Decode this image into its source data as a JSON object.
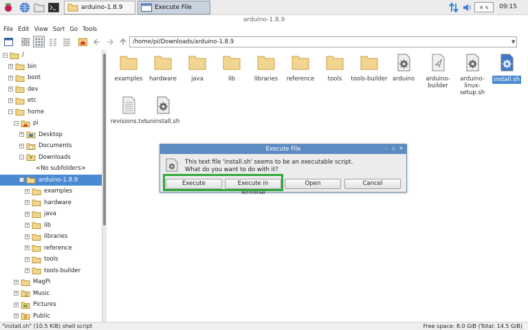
{
  "taskbar": {
    "windows": [
      "arduino-1.8.9",
      "Execute File"
    ],
    "cpu": "0 %",
    "clock": "09:15"
  },
  "window_title": "arduino-1.8.9",
  "menu": [
    "File",
    "Edit",
    "View",
    "Sort",
    "Go",
    "Tools"
  ],
  "address": "/home/pi/Downloads/arduino-1.8.9",
  "tree": [
    {
      "label": "/",
      "depth": 0,
      "exp": "-"
    },
    {
      "label": "bin",
      "depth": 1,
      "exp": "+"
    },
    {
      "label": "boot",
      "depth": 1,
      "exp": "+"
    },
    {
      "label": "dev",
      "depth": 1,
      "exp": "+"
    },
    {
      "label": "etc",
      "depth": 1,
      "exp": "+"
    },
    {
      "label": "home",
      "depth": 1,
      "exp": "-"
    },
    {
      "label": "pi",
      "depth": 2,
      "exp": "-",
      "icon": "home"
    },
    {
      "label": "Desktop",
      "depth": 3,
      "exp": "+",
      "icon": "desktop"
    },
    {
      "label": "Documents",
      "depth": 3,
      "exp": "+",
      "icon": "documents"
    },
    {
      "label": "Downloads",
      "depth": 3,
      "exp": "-",
      "icon": "downloads"
    },
    {
      "label": "<No subfolders>",
      "depth": 4,
      "exp": "",
      "icon": "none"
    },
    {
      "label": "arduino-1.8.9",
      "depth": 3,
      "exp": "-",
      "selected": true
    },
    {
      "label": "examples",
      "depth": 4,
      "exp": "+"
    },
    {
      "label": "hardware",
      "depth": 4,
      "exp": "+"
    },
    {
      "label": "java",
      "depth": 4,
      "exp": "+"
    },
    {
      "label": "lib",
      "depth": 4,
      "exp": "+"
    },
    {
      "label": "libraries",
      "depth": 4,
      "exp": "+"
    },
    {
      "label": "reference",
      "depth": 4,
      "exp": "+"
    },
    {
      "label": "tools",
      "depth": 4,
      "exp": "+"
    },
    {
      "label": "tools-builder",
      "depth": 4,
      "exp": "+"
    },
    {
      "label": "MagPi",
      "depth": 2,
      "exp": "+"
    },
    {
      "label": "Music",
      "depth": 2,
      "exp": "+",
      "icon": "music"
    },
    {
      "label": "Pictures",
      "depth": 2,
      "exp": "+",
      "icon": "pictures"
    },
    {
      "label": "Public",
      "depth": 2,
      "exp": "+",
      "icon": "public"
    }
  ],
  "files": [
    {
      "name": "examples",
      "kind": "folder"
    },
    {
      "name": "hardware",
      "kind": "folder"
    },
    {
      "name": "java",
      "kind": "folder"
    },
    {
      "name": "lib",
      "kind": "folder"
    },
    {
      "name": "libraries",
      "kind": "folder"
    },
    {
      "name": "reference",
      "kind": "folder"
    },
    {
      "name": "tools",
      "kind": "folder"
    },
    {
      "name": "tools-builder",
      "kind": "folder"
    },
    {
      "name": "arduino",
      "kind": "exec"
    },
    {
      "name": "arduino-builder",
      "kind": "builder"
    },
    {
      "name": "arduino-linux-setup.sh",
      "kind": "exec"
    },
    {
      "name": "install.sh",
      "kind": "exec",
      "selected": true
    },
    {
      "name": "revisions.txt",
      "kind": "text"
    },
    {
      "name": "uninstall.sh",
      "kind": "exec"
    }
  ],
  "dialog": {
    "title": "Execute File",
    "line1": "This text file 'install.sh' seems to be an executable script.",
    "line2": "What do you want to do with it?",
    "buttons": [
      "Execute",
      "Execute in Terminal",
      "Open",
      "Cancel"
    ]
  },
  "status": {
    "left": "\"install.sh\" (10.5 KiB) shell script",
    "right": "Free space: 8.0 GiB (Total: 14.5 GiB)"
  },
  "colors": {
    "selection": "#4a8ad2",
    "folder": "#f2d590",
    "highlight": "#2ea836"
  }
}
